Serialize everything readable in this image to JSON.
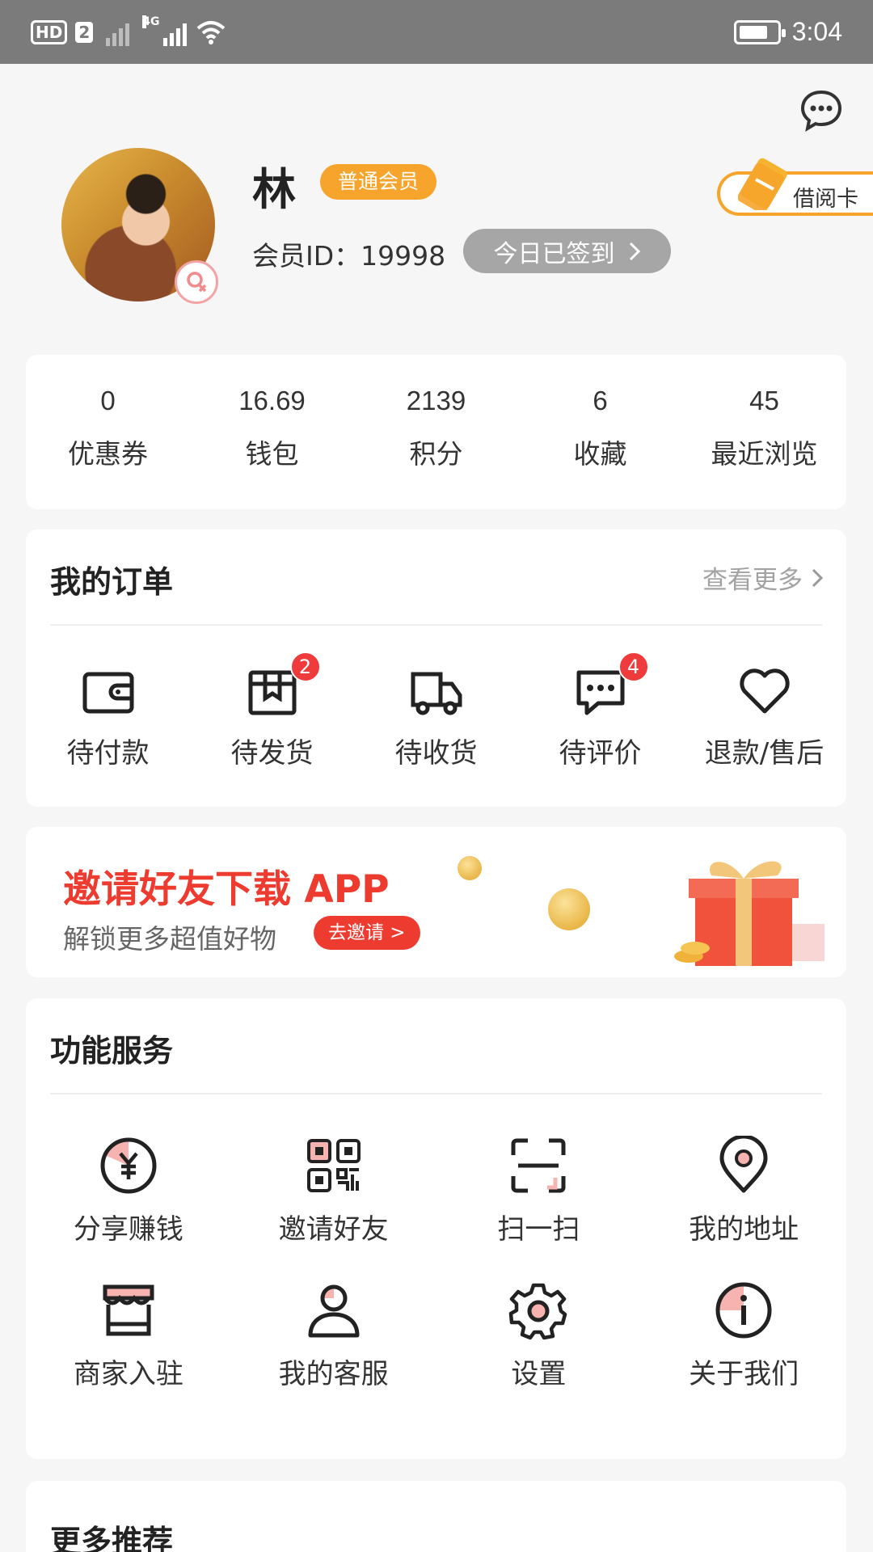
{
  "status_bar": {
    "hd": "HD",
    "sim": "2",
    "network": "4G",
    "time": "3:04"
  },
  "profile": {
    "name": "林",
    "member_level": "普通会员",
    "member_id": "会员ID：19998",
    "checkin_label": "今日已签到",
    "library_card_label": "借阅卡"
  },
  "stats": [
    {
      "value": "0",
      "label": "优惠券"
    },
    {
      "value": "16.69",
      "label": "钱包"
    },
    {
      "value": "2139",
      "label": "积分"
    },
    {
      "value": "6",
      "label": "收藏"
    },
    {
      "value": "45",
      "label": "最近浏览"
    }
  ],
  "orders": {
    "title": "我的订单",
    "view_more": "查看更多",
    "items": [
      {
        "label": "待付款",
        "icon": "wallet-icon",
        "badge": null
      },
      {
        "label": "待发货",
        "icon": "package-icon",
        "badge": "2"
      },
      {
        "label": "待收货",
        "icon": "truck-icon",
        "badge": null
      },
      {
        "label": "待评价",
        "icon": "comment-icon",
        "badge": "4"
      },
      {
        "label": "退款/售后",
        "icon": "heart-icon",
        "badge": null
      }
    ]
  },
  "banner": {
    "title": "邀请好友下载 APP",
    "subtitle": "解锁更多超值好物",
    "button": "去邀请 >"
  },
  "services": {
    "title": "功能服务",
    "items": [
      {
        "label": "分享赚钱",
        "icon": "yuan-coin-icon"
      },
      {
        "label": "邀请好友",
        "icon": "qr-code-icon"
      },
      {
        "label": "扫一扫",
        "icon": "scan-icon"
      },
      {
        "label": "我的地址",
        "icon": "location-pin-icon"
      },
      {
        "label": "商家入驻",
        "icon": "storefront-icon"
      },
      {
        "label": "我的客服",
        "icon": "person-icon"
      },
      {
        "label": "设置",
        "icon": "gear-icon"
      },
      {
        "label": "关于我们",
        "icon": "info-icon"
      }
    ]
  },
  "more": {
    "title": "更多推荐"
  },
  "colors": {
    "accent_orange": "#f7a42c",
    "accent_red": "#ee3b2f",
    "icon_pink": "#f7b3b0",
    "background": "#f6f6f6"
  }
}
